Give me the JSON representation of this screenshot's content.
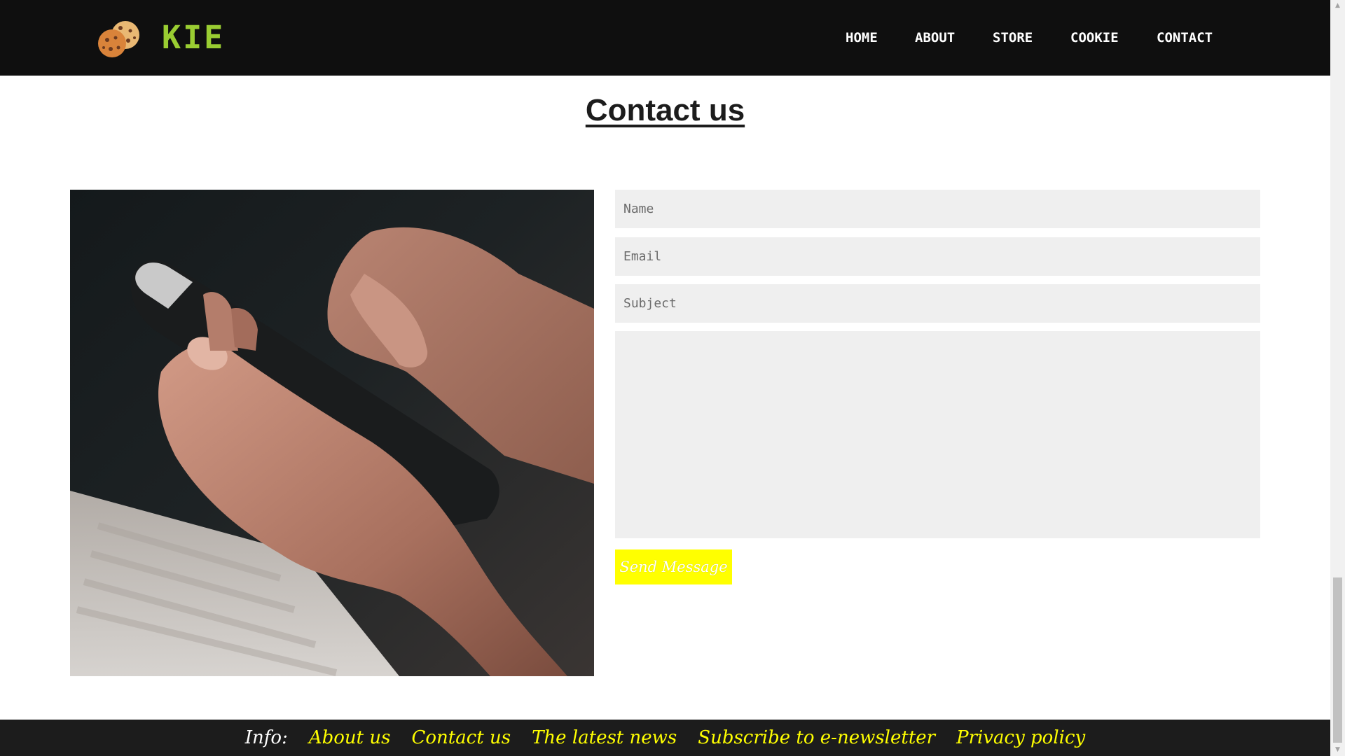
{
  "header": {
    "brand": "KIE",
    "logo_icon": "cookie-icon",
    "nav": [
      {
        "label": "HOME"
      },
      {
        "label": "ABOUT"
      },
      {
        "label": "STORE"
      },
      {
        "label": "COOKIE"
      },
      {
        "label": "CONTACT"
      }
    ]
  },
  "main": {
    "title": "Contact us",
    "form": {
      "name_placeholder": "Name",
      "email_placeholder": "Email",
      "subject_placeholder": "Subject",
      "message_placeholder": "",
      "send_label": "Send Message"
    }
  },
  "footer": {
    "info_label": "Info:",
    "links": [
      {
        "label": "About us"
      },
      {
        "label": "Contact us"
      },
      {
        "label": "The latest news"
      },
      {
        "label": "Subscribe to e-newsletter"
      },
      {
        "label": "Privacy policy"
      }
    ]
  },
  "colors": {
    "header_bg": "#0f0f0f",
    "brand": "#9acd32",
    "accent_yellow": "#ffff00",
    "footer_bg": "#1c1c1c",
    "field_bg": "#efefef"
  }
}
